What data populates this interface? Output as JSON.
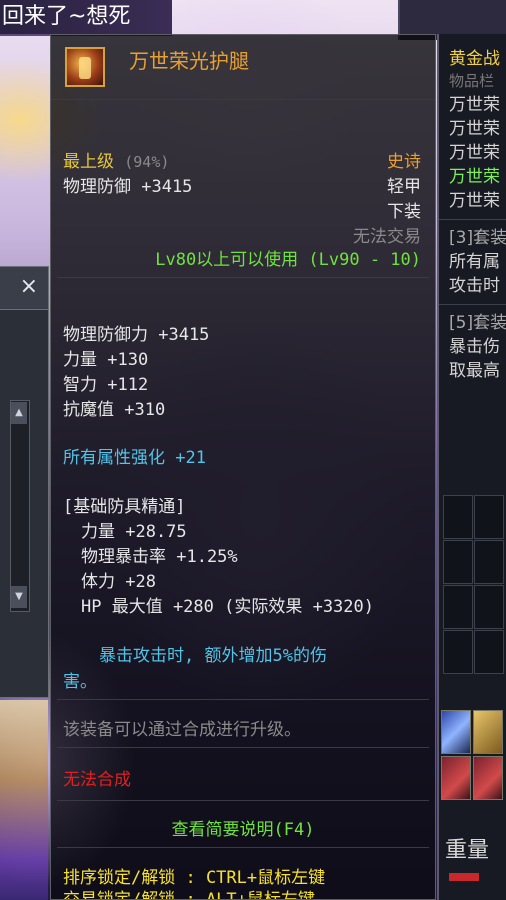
{
  "background": {
    "top_banner_text": "回来了~想死"
  },
  "tooltip": {
    "item_icon": "leg-armor-icon",
    "item_name": "万世荣光护腿",
    "grade": "最上级",
    "grade_percent": "(94%)",
    "rarity": "史诗",
    "base_stat": "物理防御 +3415",
    "armor_type": "轻甲",
    "slot": "下装",
    "trade": "无法交易",
    "level_req": "Lv80以上可以使用 (Lv90 - 10)",
    "stats": [
      "物理防御力 +3415",
      "力量 +130",
      "智力 +112",
      "抗魔值 +310"
    ],
    "all_attr": "所有属性强化 +21",
    "mastery_title": "[基础防具精通]",
    "mastery_stats": [
      "力量 +28.75",
      "物理暴击率 +1.25%",
      "体力 +28",
      "HP 最大值 +280 (实际效果 +3320)"
    ],
    "special_line1": "暴击攻击时, 额外增加5%的伤",
    "special_line2": "害。",
    "upgrade_note": "该装备可以通过合成进行升级。",
    "cannot_synthesize": "无法合成",
    "brief_button": "查看简要说明(F4)",
    "hint_lock": "排序锁定/解锁 : CTRL+鼠标左键",
    "hint_trade": "交易锁定/解锁 : ALT+鼠标左键"
  },
  "right_panel": {
    "title": "黄金战",
    "subtitle": "物品栏",
    "lines": [
      "万世荣",
      "万世荣",
      "万世荣",
      "万世荣",
      "万世荣"
    ],
    "set3": [
      "[3]套装",
      "所有属",
      "攻击时"
    ],
    "set5": [
      "[5]套装",
      "暴击伤",
      "取最高"
    ],
    "bottom": "重量"
  },
  "left_window": {
    "close_label": "×",
    "scroll_up": "▲",
    "scroll_down": "▼"
  }
}
